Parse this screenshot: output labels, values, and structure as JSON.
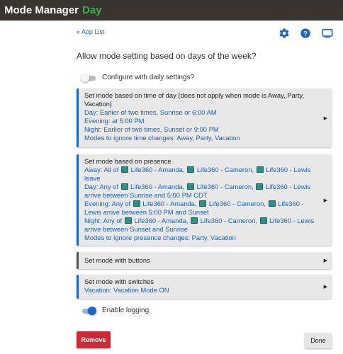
{
  "header": {
    "app_name": "Mode Manager",
    "mode_name": "Day"
  },
  "nav": {
    "back_label": "« App List"
  },
  "toolbar_icons": [
    "gear-icon",
    "help-icon",
    "display-icon"
  ],
  "heading": "Allow mode setting based on days of the week?",
  "daily_toggle": {
    "label": "Configure with daily settings?",
    "on": false
  },
  "sections": {
    "time": {
      "title": "Set mode based on time of day (does not apply when mode is Away, Party, Vacation)",
      "lines": [
        "Day: Earlier of two times, Sunrise or 6:00 AM",
        "Evening: at 5:00 PM",
        "Night: Earlier of two times, Sunset or 9:00 PM",
        "Modes to ignore time changes: Away, Party, Vacation"
      ]
    },
    "presence": {
      "title": "Set mode based on presence",
      "away": {
        "prefix": "Away: All of",
        "d1": "Life360 - Amanda,",
        "d2": "Life360 - Cameron,",
        "d3": "Life360 - Lewis",
        "suffix": "leave"
      },
      "day": {
        "prefix": "Day: Any of",
        "d1": "Life360 - Amanda,",
        "d2": "Life360 - Cameron,",
        "d3": "Life360 - Lewis",
        "suffix": "arrive between Sunrise and 5:00 PM CDT"
      },
      "evening": {
        "prefix": "Evening: Any of",
        "d1": "Life360 - Amanda,",
        "d2": "Life360 - Cameron,",
        "d3": "Life360 - Lewis",
        "suffix": "arrive between 5:00 PM and Sunset"
      },
      "night": {
        "prefix": "Night: Any of",
        "d1": "Life360 - Amanda,",
        "d2": "Life360 - Cameron,",
        "d3": "Life360 - Lewis",
        "suffix": "arrive between Sunset and Sunrise"
      },
      "ignore": "Modes to ignore presence changes: Party, Vacation"
    },
    "buttons": {
      "title": "Set mode with buttons"
    },
    "switches": {
      "title": "Set mode with switches",
      "line": "Vacation: Vacation Mode ON"
    }
  },
  "logging_toggle": {
    "label": "Enable logging",
    "on": true
  },
  "actions": {
    "remove_label": "Remove",
    "done_label": "Done"
  },
  "colors": {
    "accent": "#1e65c6",
    "remove": "#cc2a36",
    "header_bg": "#3a3430",
    "mode_green": "#37b24d"
  }
}
